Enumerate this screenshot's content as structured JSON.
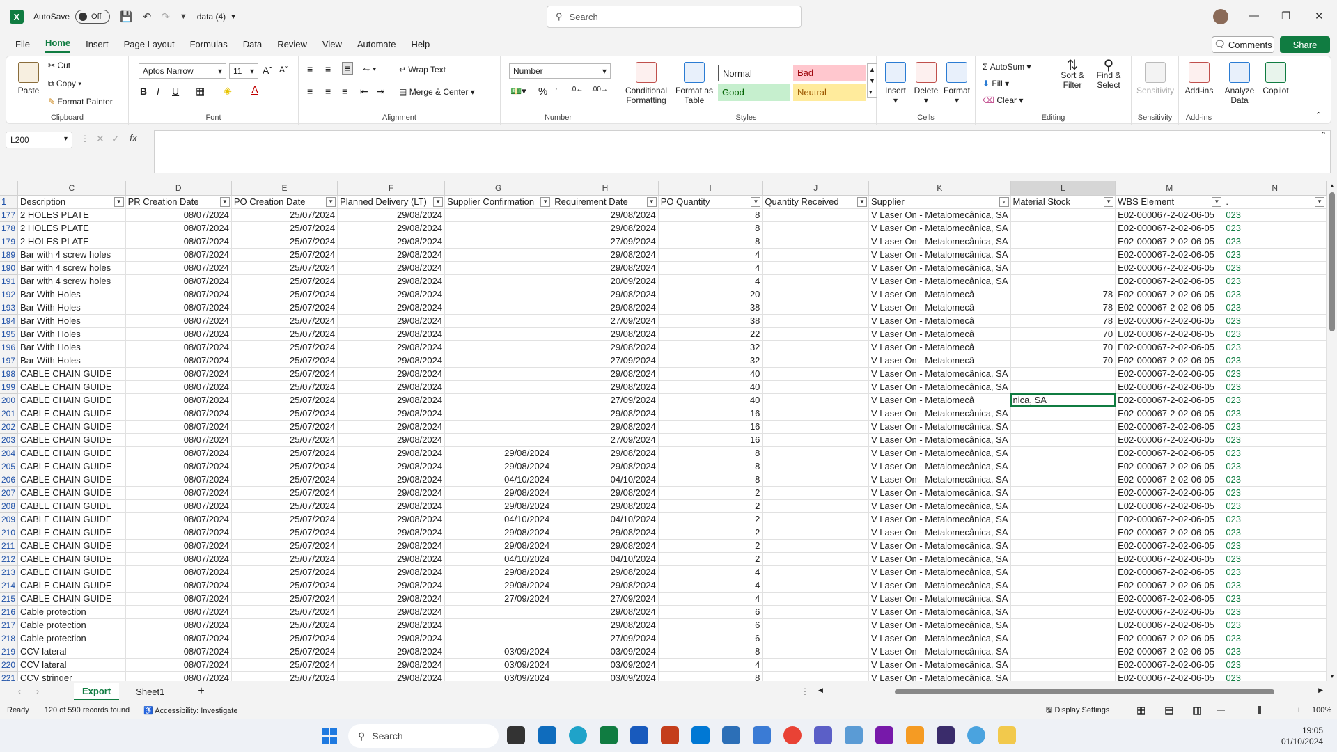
{
  "window": {
    "autosave_label": "AutoSave",
    "autosave_state": "Off",
    "file_name": "data (4)",
    "search_placeholder": "Search"
  },
  "menu": {
    "tabs": [
      "File",
      "Home",
      "Insert",
      "Page Layout",
      "Formulas",
      "Data",
      "Review",
      "View",
      "Automate",
      "Help"
    ],
    "active": "Home",
    "comments": "Comments",
    "share": "Share"
  },
  "ribbon": {
    "clipboard": {
      "paste": "Paste",
      "cut": "Cut",
      "copy": "Copy",
      "format_painter": "Format Painter",
      "label": "Clipboard"
    },
    "font": {
      "name": "Aptos Narrow",
      "size": "11",
      "label": "Font"
    },
    "alignment": {
      "wrap": "Wrap Text",
      "merge": "Merge & Center",
      "label": "Alignment"
    },
    "number": {
      "format": "Number",
      "label": "Number"
    },
    "styles": {
      "conditional": "Conditional Formatting",
      "format_table": "Format as Table",
      "normal": "Normal",
      "bad": "Bad",
      "good": "Good",
      "neutral": "Neutral",
      "label": "Styles"
    },
    "cells": {
      "insert": "Insert",
      "delete": "Delete",
      "format": "Format",
      "label": "Cells"
    },
    "editing": {
      "autosum": "AutoSum",
      "fill": "Fill",
      "clear": "Clear",
      "sort": "Sort & Filter",
      "find": "Find & Select",
      "label": "Editing"
    },
    "sensitivity": {
      "btn": "Sensitivity",
      "label": "Sensitivity"
    },
    "addins": {
      "btn": "Add-ins",
      "label": "Add-ins"
    },
    "analyze": "Analyze Data",
    "copilot": "Copilot"
  },
  "formula": {
    "namebox": "L200",
    "fx": "fx",
    "content": ""
  },
  "columns": [
    "C",
    "D",
    "E",
    "F",
    "G",
    "H",
    "I",
    "J",
    "K",
    "L",
    "M",
    "N"
  ],
  "headers": [
    "Description",
    "PR Creation Date",
    "PO Creation Date",
    "Planned Delivery (LT)",
    "Supplier Confirmation",
    "Requirement Date",
    "PO Quantity",
    "Quantity Received",
    "Supplier",
    "Material Stock",
    "WBS Element",
    "."
  ],
  "rows": [
    {
      "n": "177",
      "c": "2 HOLES PLATE",
      "d": "08/07/2024",
      "e": "25/07/2024",
      "f": "29/08/2024",
      "g": "",
      "h": "29/08/2024",
      "i": "8",
      "j": "",
      "k": "V Laser On - Metalomecânica, SA",
      "l": "",
      "m": "E02-000067-2-02-06-05",
      "nn": "023"
    },
    {
      "n": "178",
      "c": "2 HOLES PLATE",
      "d": "08/07/2024",
      "e": "25/07/2024",
      "f": "29/08/2024",
      "g": "",
      "h": "29/08/2024",
      "i": "8",
      "j": "",
      "k": "V Laser On - Metalomecânica, SA",
      "l": "",
      "m": "E02-000067-2-02-06-05",
      "nn": "023"
    },
    {
      "n": "179",
      "c": "2 HOLES PLATE",
      "d": "08/07/2024",
      "e": "25/07/2024",
      "f": "29/08/2024",
      "g": "",
      "h": "27/09/2024",
      "i": "8",
      "j": "",
      "k": "V Laser On - Metalomecânica, SA",
      "l": "",
      "m": "E02-000067-2-02-06-05",
      "nn": "023"
    },
    {
      "n": "189",
      "c": "Bar with 4 screw holes",
      "d": "08/07/2024",
      "e": "25/07/2024",
      "f": "29/08/2024",
      "g": "",
      "h": "29/08/2024",
      "i": "4",
      "j": "",
      "k": "V Laser On - Metalomecânica, SA",
      "l": "",
      "m": "E02-000067-2-02-06-05",
      "nn": "023"
    },
    {
      "n": "190",
      "c": "Bar with 4 screw holes",
      "d": "08/07/2024",
      "e": "25/07/2024",
      "f": "29/08/2024",
      "g": "",
      "h": "29/08/2024",
      "i": "4",
      "j": "",
      "k": "V Laser On - Metalomecânica, SA",
      "l": "",
      "m": "E02-000067-2-02-06-05",
      "nn": "023"
    },
    {
      "n": "191",
      "c": "Bar with 4 screw holes",
      "d": "08/07/2024",
      "e": "25/07/2024",
      "f": "29/08/2024",
      "g": "",
      "h": "20/09/2024",
      "i": "4",
      "j": "",
      "k": "V Laser On - Metalomecânica, SA",
      "l": "",
      "m": "E02-000067-2-02-06-05",
      "nn": "023"
    },
    {
      "n": "192",
      "c": "Bar With Holes",
      "d": "08/07/2024",
      "e": "25/07/2024",
      "f": "29/08/2024",
      "g": "",
      "h": "29/08/2024",
      "i": "20",
      "j": "",
      "k": "V Laser On - Metalomecâ",
      "l": "78",
      "m": "E02-000067-2-02-06-05",
      "nn": "023"
    },
    {
      "n": "193",
      "c": "Bar With Holes",
      "d": "08/07/2024",
      "e": "25/07/2024",
      "f": "29/08/2024",
      "g": "",
      "h": "29/08/2024",
      "i": "38",
      "j": "",
      "k": "V Laser On - Metalomecâ",
      "l": "78",
      "m": "E02-000067-2-02-06-05",
      "nn": "023"
    },
    {
      "n": "194",
      "c": "Bar With Holes",
      "d": "08/07/2024",
      "e": "25/07/2024",
      "f": "29/08/2024",
      "g": "",
      "h": "27/09/2024",
      "i": "38",
      "j": "",
      "k": "V Laser On - Metalomecâ",
      "l": "78",
      "m": "E02-000067-2-02-06-05",
      "nn": "023"
    },
    {
      "n": "195",
      "c": "Bar With Holes",
      "d": "08/07/2024",
      "e": "25/07/2024",
      "f": "29/08/2024",
      "g": "",
      "h": "29/08/2024",
      "i": "22",
      "j": "",
      "k": "V Laser On - Metalomecâ",
      "l": "70",
      "m": "E02-000067-2-02-06-05",
      "nn": "023"
    },
    {
      "n": "196",
      "c": "Bar With Holes",
      "d": "08/07/2024",
      "e": "25/07/2024",
      "f": "29/08/2024",
      "g": "",
      "h": "29/08/2024",
      "i": "32",
      "j": "",
      "k": "V Laser On - Metalomecâ",
      "l": "70",
      "m": "E02-000067-2-02-06-05",
      "nn": "023"
    },
    {
      "n": "197",
      "c": "Bar With Holes",
      "d": "08/07/2024",
      "e": "25/07/2024",
      "f": "29/08/2024",
      "g": "",
      "h": "27/09/2024",
      "i": "32",
      "j": "",
      "k": "V Laser On - Metalomecâ",
      "l": "70",
      "m": "E02-000067-2-02-06-05",
      "nn": "023"
    },
    {
      "n": "198",
      "c": "CABLE CHAIN GUIDE",
      "d": "08/07/2024",
      "e": "25/07/2024",
      "f": "29/08/2024",
      "g": "",
      "h": "29/08/2024",
      "i": "40",
      "j": "",
      "k": "V Laser On - Metalomecânica, SA",
      "l": "",
      "m": "E02-000067-2-02-06-05",
      "nn": "023"
    },
    {
      "n": "199",
      "c": "CABLE CHAIN GUIDE",
      "d": "08/07/2024",
      "e": "25/07/2024",
      "f": "29/08/2024",
      "g": "",
      "h": "29/08/2024",
      "i": "40",
      "j": "",
      "k": "V Laser On - Metalomecânica, SA",
      "l": "",
      "m": "E02-000067-2-02-06-05",
      "nn": "023"
    },
    {
      "n": "200",
      "c": "CABLE CHAIN GUIDE",
      "d": "08/07/2024",
      "e": "25/07/2024",
      "f": "29/08/2024",
      "g": "",
      "h": "27/09/2024",
      "i": "40",
      "j": "",
      "k": "V Laser On - Metalomecâ",
      "l": "nica, SA",
      "m": "E02-000067-2-02-06-05",
      "nn": "023"
    },
    {
      "n": "201",
      "c": "CABLE CHAIN GUIDE",
      "d": "08/07/2024",
      "e": "25/07/2024",
      "f": "29/08/2024",
      "g": "",
      "h": "29/08/2024",
      "i": "16",
      "j": "",
      "k": "V Laser On - Metalomecânica, SA",
      "l": "",
      "m": "E02-000067-2-02-06-05",
      "nn": "023"
    },
    {
      "n": "202",
      "c": "CABLE CHAIN GUIDE",
      "d": "08/07/2024",
      "e": "25/07/2024",
      "f": "29/08/2024",
      "g": "",
      "h": "29/08/2024",
      "i": "16",
      "j": "",
      "k": "V Laser On - Metalomecânica, SA",
      "l": "",
      "m": "E02-000067-2-02-06-05",
      "nn": "023"
    },
    {
      "n": "203",
      "c": "CABLE CHAIN GUIDE",
      "d": "08/07/2024",
      "e": "25/07/2024",
      "f": "29/08/2024",
      "g": "",
      "h": "27/09/2024",
      "i": "16",
      "j": "",
      "k": "V Laser On - Metalomecânica, SA",
      "l": "",
      "m": "E02-000067-2-02-06-05",
      "nn": "023"
    },
    {
      "n": "204",
      "c": "CABLE CHAIN GUIDE",
      "d": "08/07/2024",
      "e": "25/07/2024",
      "f": "29/08/2024",
      "g": "29/08/2024",
      "h": "29/08/2024",
      "i": "8",
      "j": "",
      "k": "V Laser On - Metalomecânica, SA",
      "l": "",
      "m": "E02-000067-2-02-06-05",
      "nn": "023"
    },
    {
      "n": "205",
      "c": "CABLE CHAIN GUIDE",
      "d": "08/07/2024",
      "e": "25/07/2024",
      "f": "29/08/2024",
      "g": "29/08/2024",
      "h": "29/08/2024",
      "i": "8",
      "j": "",
      "k": "V Laser On - Metalomecânica, SA",
      "l": "",
      "m": "E02-000067-2-02-06-05",
      "nn": "023"
    },
    {
      "n": "206",
      "c": "CABLE CHAIN GUIDE",
      "d": "08/07/2024",
      "e": "25/07/2024",
      "f": "29/08/2024",
      "g": "04/10/2024",
      "h": "04/10/2024",
      "i": "8",
      "j": "",
      "k": "V Laser On - Metalomecânica, SA",
      "l": "",
      "m": "E02-000067-2-02-06-05",
      "nn": "023"
    },
    {
      "n": "207",
      "c": "CABLE CHAIN GUIDE",
      "d": "08/07/2024",
      "e": "25/07/2024",
      "f": "29/08/2024",
      "g": "29/08/2024",
      "h": "29/08/2024",
      "i": "2",
      "j": "",
      "k": "V Laser On - Metalomecânica, SA",
      "l": "",
      "m": "E02-000067-2-02-06-05",
      "nn": "023"
    },
    {
      "n": "208",
      "c": "CABLE CHAIN GUIDE",
      "d": "08/07/2024",
      "e": "25/07/2024",
      "f": "29/08/2024",
      "g": "29/08/2024",
      "h": "29/08/2024",
      "i": "2",
      "j": "",
      "k": "V Laser On - Metalomecânica, SA",
      "l": "",
      "m": "E02-000067-2-02-06-05",
      "nn": "023"
    },
    {
      "n": "209",
      "c": "CABLE CHAIN GUIDE",
      "d": "08/07/2024",
      "e": "25/07/2024",
      "f": "29/08/2024",
      "g": "04/10/2024",
      "h": "04/10/2024",
      "i": "2",
      "j": "",
      "k": "V Laser On - Metalomecânica, SA",
      "l": "",
      "m": "E02-000067-2-02-06-05",
      "nn": "023"
    },
    {
      "n": "210",
      "c": "CABLE CHAIN GUIDE",
      "d": "08/07/2024",
      "e": "25/07/2024",
      "f": "29/08/2024",
      "g": "29/08/2024",
      "h": "29/08/2024",
      "i": "2",
      "j": "",
      "k": "V Laser On - Metalomecânica, SA",
      "l": "",
      "m": "E02-000067-2-02-06-05",
      "nn": "023"
    },
    {
      "n": "211",
      "c": "CABLE CHAIN GUIDE",
      "d": "08/07/2024",
      "e": "25/07/2024",
      "f": "29/08/2024",
      "g": "29/08/2024",
      "h": "29/08/2024",
      "i": "2",
      "j": "",
      "k": "V Laser On - Metalomecânica, SA",
      "l": "",
      "m": "E02-000067-2-02-06-05",
      "nn": "023"
    },
    {
      "n": "212",
      "c": "CABLE CHAIN GUIDE",
      "d": "08/07/2024",
      "e": "25/07/2024",
      "f": "29/08/2024",
      "g": "04/10/2024",
      "h": "04/10/2024",
      "i": "2",
      "j": "",
      "k": "V Laser On - Metalomecânica, SA",
      "l": "",
      "m": "E02-000067-2-02-06-05",
      "nn": "023"
    },
    {
      "n": "213",
      "c": "CABLE CHAIN GUIDE",
      "d": "08/07/2024",
      "e": "25/07/2024",
      "f": "29/08/2024",
      "g": "29/08/2024",
      "h": "29/08/2024",
      "i": "4",
      "j": "",
      "k": "V Laser On - Metalomecânica, SA",
      "l": "",
      "m": "E02-000067-2-02-06-05",
      "nn": "023"
    },
    {
      "n": "214",
      "c": "CABLE CHAIN GUIDE",
      "d": "08/07/2024",
      "e": "25/07/2024",
      "f": "29/08/2024",
      "g": "29/08/2024",
      "h": "29/08/2024",
      "i": "4",
      "j": "",
      "k": "V Laser On - Metalomecânica, SA",
      "l": "",
      "m": "E02-000067-2-02-06-05",
      "nn": "023"
    },
    {
      "n": "215",
      "c": "CABLE CHAIN GUIDE",
      "d": "08/07/2024",
      "e": "25/07/2024",
      "f": "29/08/2024",
      "g": "27/09/2024",
      "h": "27/09/2024",
      "i": "4",
      "j": "",
      "k": "V Laser On - Metalomecânica, SA",
      "l": "",
      "m": "E02-000067-2-02-06-05",
      "nn": "023"
    },
    {
      "n": "216",
      "c": "Cable protection",
      "d": "08/07/2024",
      "e": "25/07/2024",
      "f": "29/08/2024",
      "g": "",
      "h": "29/08/2024",
      "i": "6",
      "j": "",
      "k": "V Laser On - Metalomecânica, SA",
      "l": "",
      "m": "E02-000067-2-02-06-05",
      "nn": "023"
    },
    {
      "n": "217",
      "c": "Cable protection",
      "d": "08/07/2024",
      "e": "25/07/2024",
      "f": "29/08/2024",
      "g": "",
      "h": "29/08/2024",
      "i": "6",
      "j": "",
      "k": "V Laser On - Metalomecânica, SA",
      "l": "",
      "m": "E02-000067-2-02-06-05",
      "nn": "023"
    },
    {
      "n": "218",
      "c": "Cable protection",
      "d": "08/07/2024",
      "e": "25/07/2024",
      "f": "29/08/2024",
      "g": "",
      "h": "27/09/2024",
      "i": "6",
      "j": "",
      "k": "V Laser On - Metalomecânica, SA",
      "l": "",
      "m": "E02-000067-2-02-06-05",
      "nn": "023"
    },
    {
      "n": "219",
      "c": "CCV lateral",
      "d": "08/07/2024",
      "e": "25/07/2024",
      "f": "29/08/2024",
      "g": "03/09/2024",
      "h": "03/09/2024",
      "i": "8",
      "j": "",
      "k": "V Laser On - Metalomecânica, SA",
      "l": "",
      "m": "E02-000067-2-02-06-05",
      "nn": "023"
    },
    {
      "n": "220",
      "c": "CCV lateral",
      "d": "08/07/2024",
      "e": "25/07/2024",
      "f": "29/08/2024",
      "g": "03/09/2024",
      "h": "03/09/2024",
      "i": "4",
      "j": "",
      "k": "V Laser On - Metalomecânica, SA",
      "l": "",
      "m": "E02-000067-2-02-06-05",
      "nn": "023"
    },
    {
      "n": "221",
      "c": "CCV stringer",
      "d": "08/07/2024",
      "e": "25/07/2024",
      "f": "29/08/2024",
      "g": "03/09/2024",
      "h": "03/09/2024",
      "i": "8",
      "j": "",
      "k": "V Laser On - Metalomecânica, SA",
      "l": "",
      "m": "E02-000067-2-02-06-05",
      "nn": "023"
    }
  ],
  "sheets": {
    "tabs": [
      "Export",
      "Sheet1"
    ],
    "active": "Export",
    "add": "+"
  },
  "status": {
    "ready": "Ready",
    "records": "120 of 590 records found",
    "accessibility": "Accessibility: Investigate",
    "display": "Display Settings",
    "zoom": "100%"
  },
  "taskbar": {
    "search": "Search",
    "time": "19:05",
    "date": "01/10/2024"
  }
}
